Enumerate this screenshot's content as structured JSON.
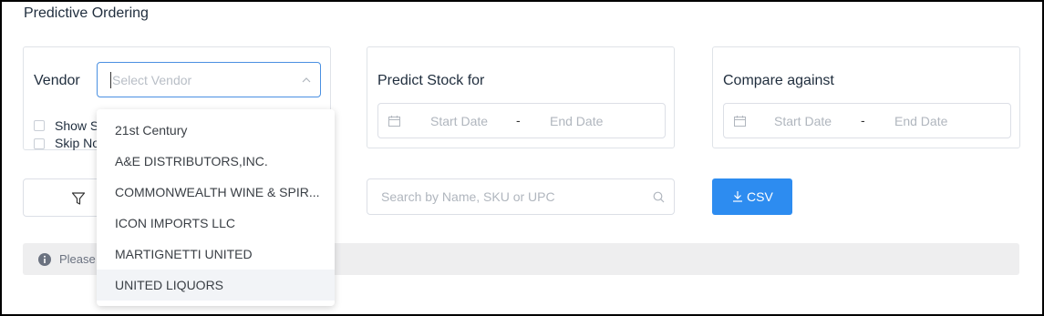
{
  "page": {
    "title": "Predictive Ordering"
  },
  "vendor": {
    "label": "Vendor",
    "placeholder": "Select Vendor",
    "checkbox1_label": "Show S",
    "checkbox2_label": "Skip No",
    "options": [
      "21st Century",
      "A&E DISTRIBUTORS,INC.",
      "COMMONWEALTH WINE & SPIR...",
      "ICON IMPORTS LLC",
      "MARTIGNETTI UNITED",
      "UNITED LIQUORS"
    ],
    "hovered_option": "UNITED LIQUORS"
  },
  "predict": {
    "label": "Predict Stock for",
    "start_placeholder": "Start Date",
    "separator": "-",
    "end_placeholder": "End Date"
  },
  "compare": {
    "label": "Compare against",
    "start_placeholder": "Start Date",
    "separator": "-",
    "end_placeholder": "End Date"
  },
  "toolbar": {
    "search_placeholder": "Search by Name, SKU or UPC",
    "csv_label": "CSV"
  },
  "notice": {
    "text": "Please"
  },
  "colors": {
    "accent": "#2d8cf0",
    "focus_border": "#4a90e2"
  },
  "icons": [
    "calendar-icon",
    "filter-icon",
    "search-icon",
    "download-icon",
    "info-icon",
    "chevron-up-icon"
  ]
}
